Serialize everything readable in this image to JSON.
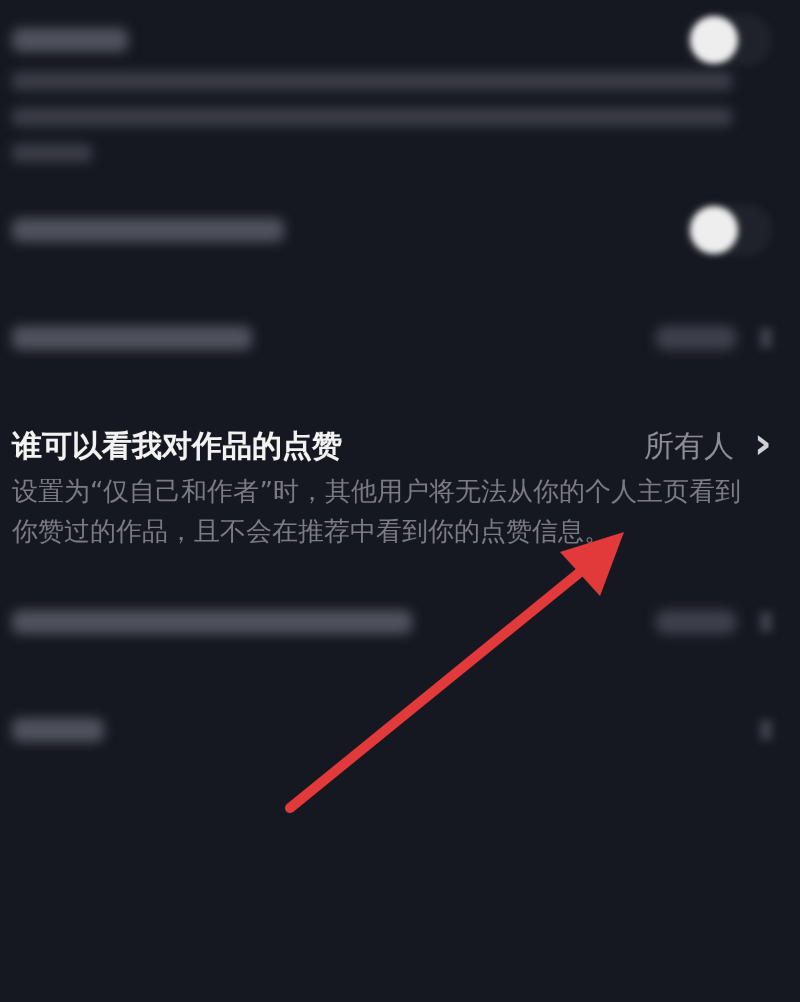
{
  "settings": [
    {
      "kind": "blurred-toggle-note",
      "on": false
    },
    {
      "kind": "blurred-toggle",
      "on": false
    },
    {
      "kind": "blurred-link"
    },
    {
      "kind": "link",
      "label": "谁可以看我对作品的点赞",
      "value": "所有人",
      "chevron": "›",
      "description": "设置为“仅自己和作者”时，其他用户将无法从你的个人主页看到你赞过的作品，且不会在推荐中看到你的点赞信息。"
    },
    {
      "kind": "blurred-link"
    },
    {
      "kind": "blurred-link-bare"
    }
  ],
  "annotation": {
    "kind": "arrow"
  }
}
